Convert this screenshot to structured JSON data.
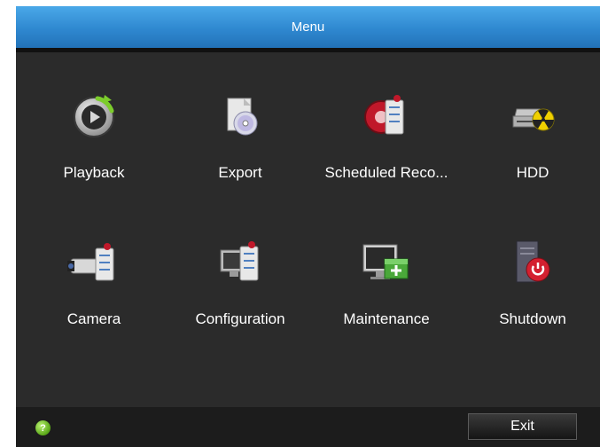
{
  "window": {
    "title": "Menu"
  },
  "menu": {
    "items": [
      {
        "label": "Playback",
        "icon": "playback-icon"
      },
      {
        "label": "Export",
        "icon": "export-disc-icon"
      },
      {
        "label": "Scheduled Reco...",
        "icon": "record-schedule-icon"
      },
      {
        "label": "HDD",
        "icon": "hdd-icon"
      },
      {
        "label": "Camera",
        "icon": "camera-config-icon"
      },
      {
        "label": "Configuration",
        "icon": "configuration-icon"
      },
      {
        "label": "Maintenance",
        "icon": "maintenance-icon"
      },
      {
        "label": "Shutdown",
        "icon": "shutdown-icon"
      }
    ]
  },
  "footer": {
    "help_icon": "help-icon",
    "help_glyph": "?",
    "exit_label": "Exit"
  },
  "colors": {
    "title_bar": "#2f88d0",
    "background": "#2b2b2b",
    "footer": "#1c1c1c",
    "text": "#ffffff"
  }
}
